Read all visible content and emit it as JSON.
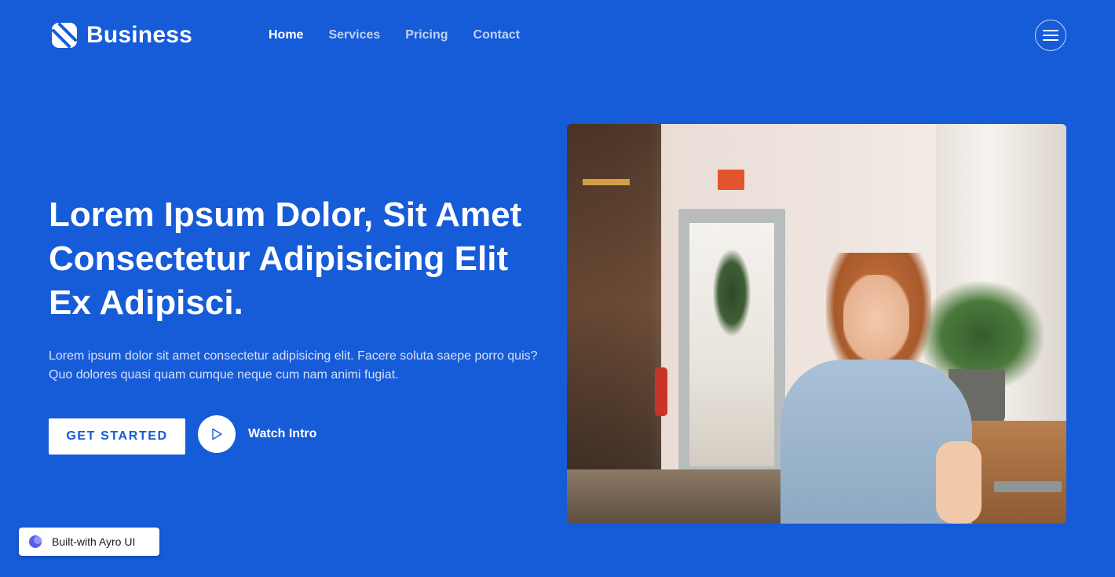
{
  "brand": {
    "name": "Business"
  },
  "nav": {
    "items": [
      {
        "label": "Home",
        "active": true
      },
      {
        "label": "Services",
        "active": false
      },
      {
        "label": "Pricing",
        "active": false
      },
      {
        "label": "Contact",
        "active": false
      }
    ]
  },
  "hero": {
    "title": "Lorem Ipsum Dolor, Sit Amet Consectetur Adipisicing Elit Ex Adipisci.",
    "description": "Lorem ipsum dolor sit amet consectetur adipisicing elit. Facere soluta saepe porro quis? Quo dolores quasi quam cumque neque cum nam animi fugiat.",
    "cta_label": "GET STARTED",
    "video_label": "Watch Intro"
  },
  "icons": {
    "logo": "brand-logo-icon",
    "menu": "hamburger-menu-icon",
    "play": "play-icon",
    "badge": "ayro-logo-icon"
  },
  "badge": {
    "label": "Built-with Ayro UI"
  },
  "colors": {
    "background": "#165bd8",
    "text": "#ffffff",
    "cta_text": "#165bd8"
  }
}
